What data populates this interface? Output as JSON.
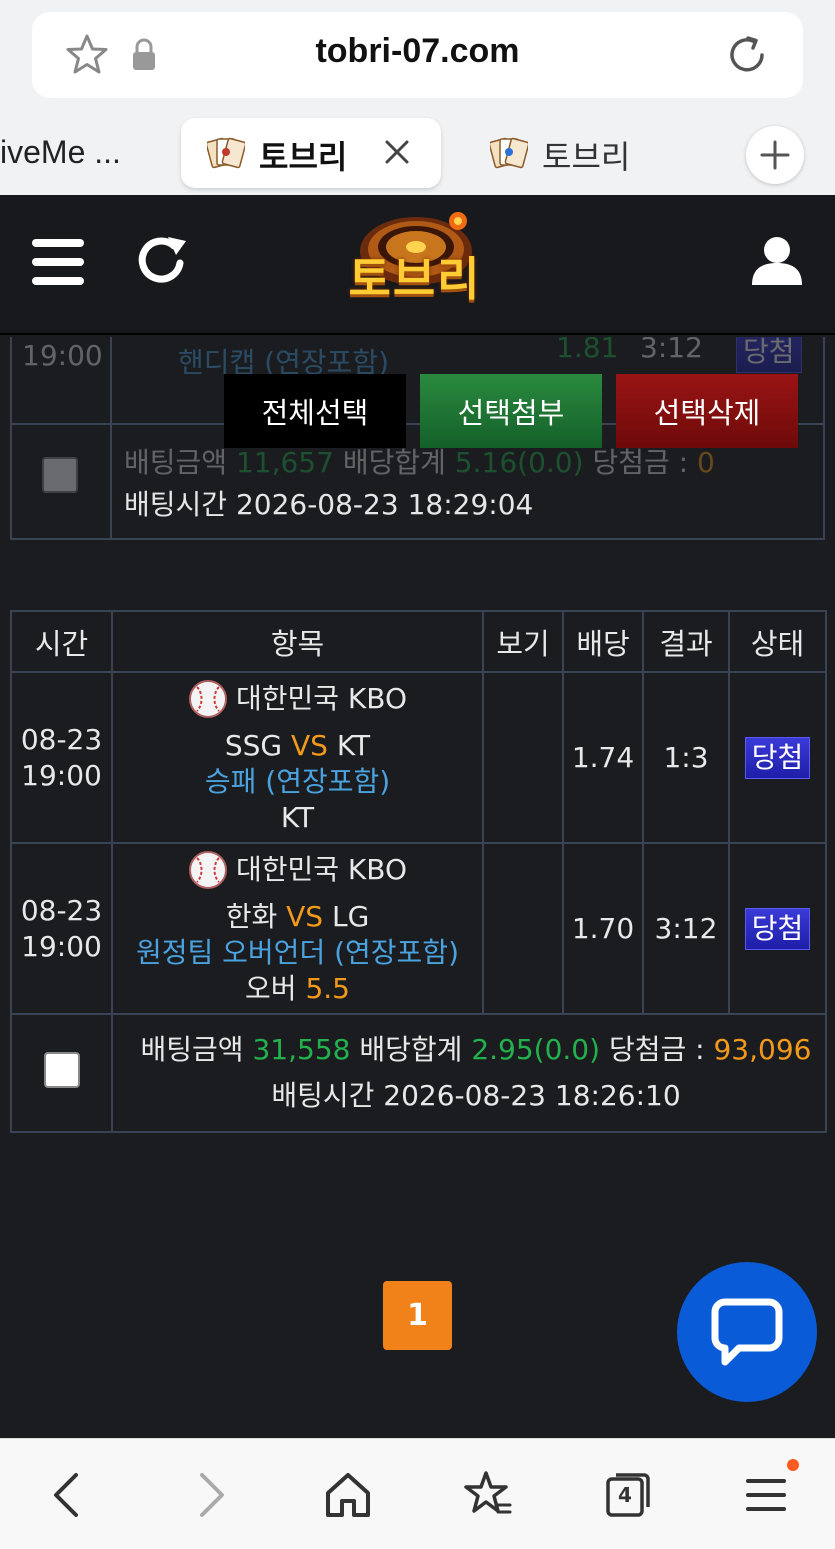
{
  "browser": {
    "url": "tobri-07.com",
    "tabs": [
      {
        "label": "iveMe ..."
      },
      {
        "label": "토브리"
      },
      {
        "label": "토브리"
      }
    ],
    "tab_count": "4"
  },
  "site": {
    "logo_text": "토브리"
  },
  "actions": {
    "select_all": "전체선택",
    "attach_selected": "선택첨부",
    "delete_selected": "선택삭제"
  },
  "prev_slip": {
    "time": "19:00",
    "market": "핸디캡 (연장포함)",
    "odds": "1.81",
    "result": "3:12",
    "status": "당첨",
    "summary_prefix": "배팅금액",
    "amount": "11,657",
    "total_label": "배당합계",
    "total_odds": "5.16(0.0)",
    "win_label": "당첨금 :",
    "win_amount": "0",
    "bet_time": "배팅시간 2026-08-23 18:29:04"
  },
  "table": {
    "headers": [
      "시간",
      "항목",
      "보기",
      "배당",
      "결과",
      "상태"
    ],
    "rows": [
      {
        "date": "08-23",
        "time": "19:00",
        "league": "대한민국 KBO",
        "home": "SSG",
        "vs": "VS",
        "away": "KT",
        "market": "승패 (연장포함)",
        "pick": "KT",
        "pick_value": "",
        "odds": "1.74",
        "result": "1:3",
        "status": "당첨"
      },
      {
        "date": "08-23",
        "time": "19:00",
        "league": "대한민국 KBO",
        "home": "한화",
        "vs": "VS",
        "away": "LG",
        "market": "원정팀 오버언더 (연장포함)",
        "pick": "오버",
        "pick_value": "5.5",
        "odds": "1.70",
        "result": "3:12",
        "status": "당첨"
      }
    ],
    "summary": {
      "amount_label": "배팅금액",
      "amount": "31,558",
      "total_label": "배당합계",
      "total_odds": "2.95(0.0)",
      "win_label": "당첨금 :",
      "win_amount": "93,096",
      "bet_time": "배팅시간 2026-08-23 18:26:10"
    }
  },
  "pagination": {
    "current": "1"
  },
  "colors": {
    "accent_orange": "#f39a1a",
    "odds_green": "#22b14c",
    "market_blue": "#4aa3df",
    "badge_blue": "#2525c0",
    "chat_blue": "#0a5bd8"
  }
}
